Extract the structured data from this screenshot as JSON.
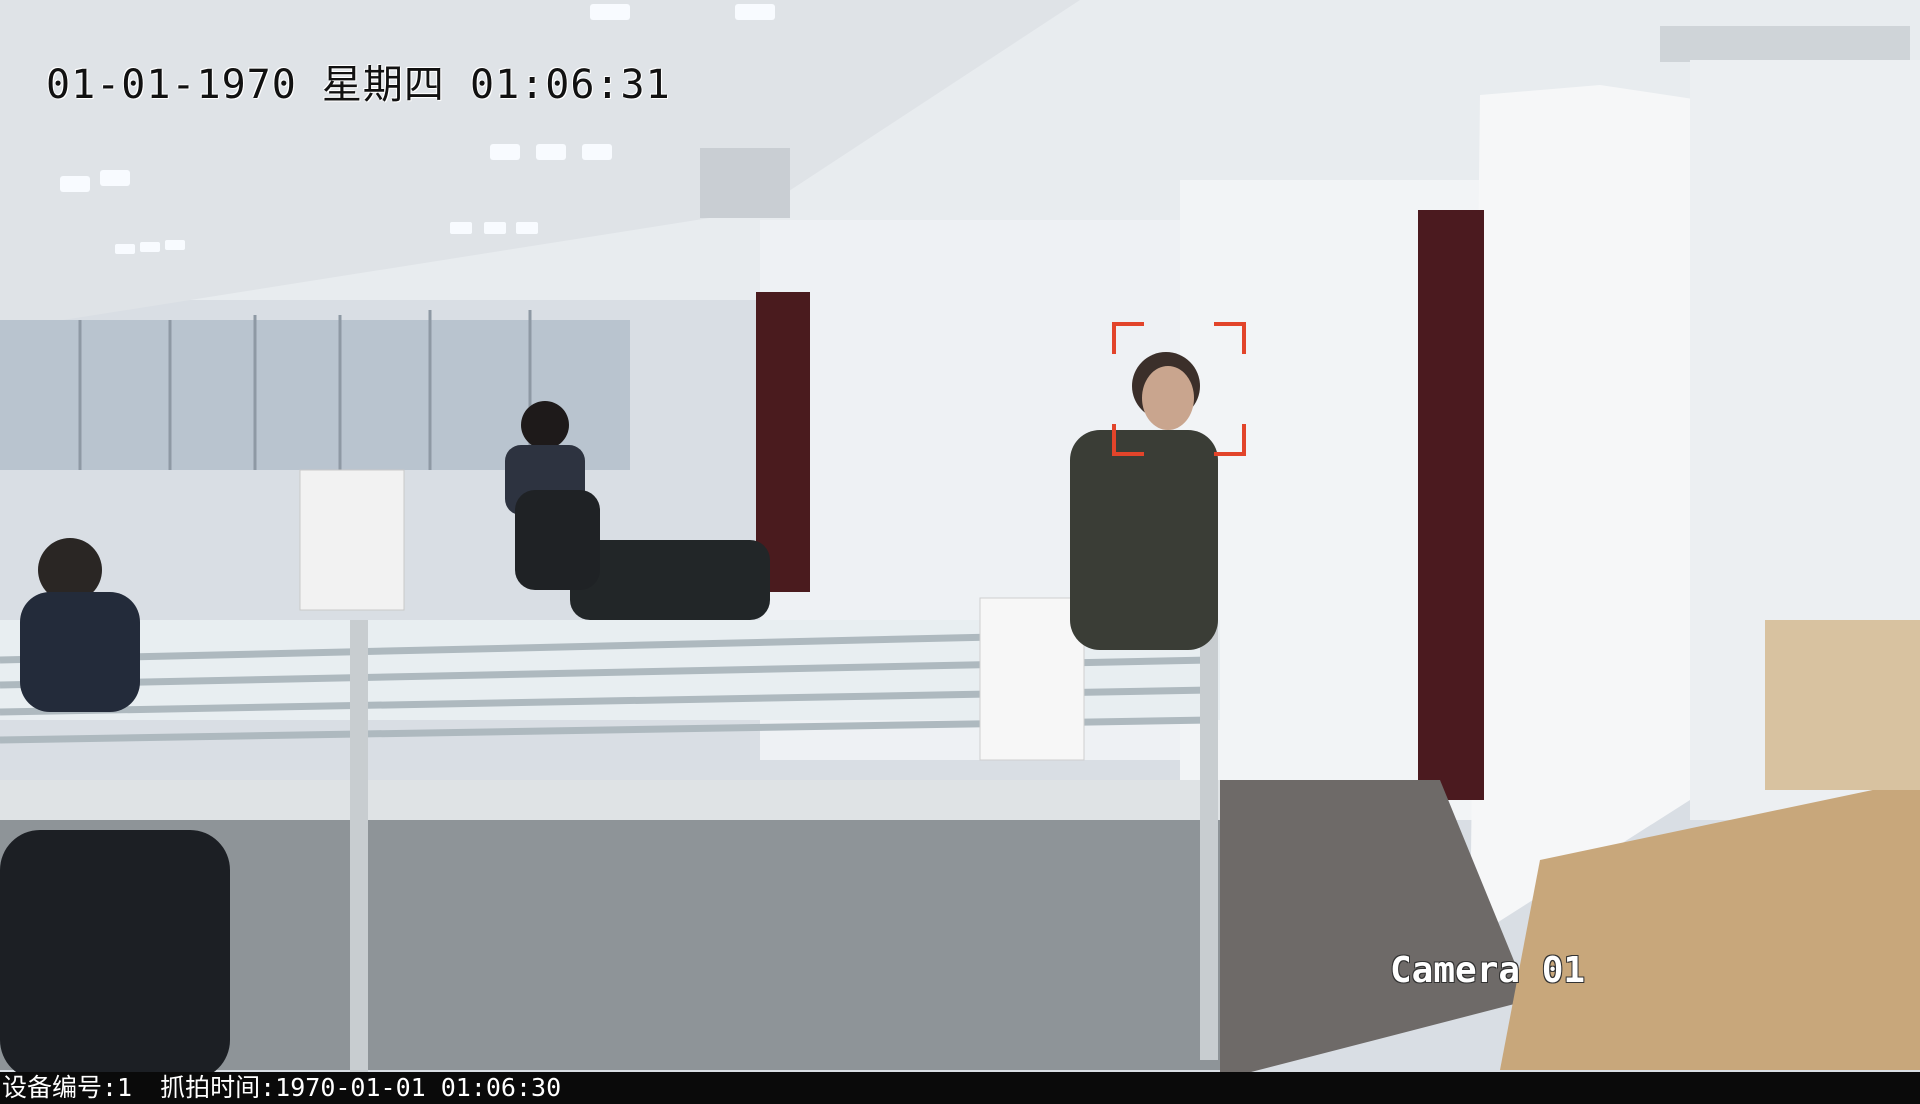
{
  "osd": {
    "date": "01-01-1970",
    "weekday": "星期四",
    "time": "01:06:31",
    "camera_name": "Camera 01"
  },
  "caption": {
    "device": "设备编号:1",
    "capture": "抓拍时间:1970-01-01 01:06:30"
  },
  "overlay": {
    "face_box_color": "#e2442a"
  }
}
